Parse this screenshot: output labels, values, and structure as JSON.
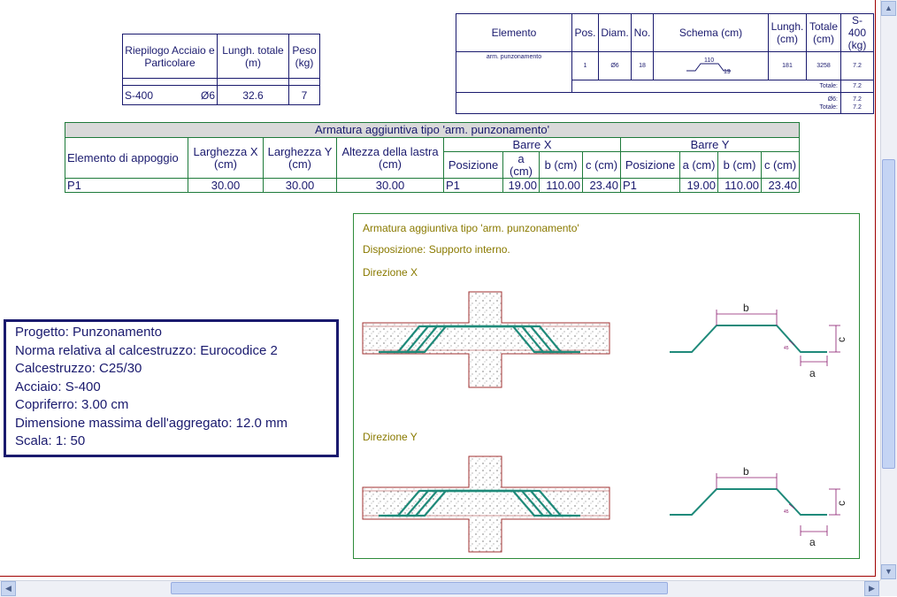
{
  "riepilogo": {
    "header": [
      "Riepilogo Acciaio e Particolare",
      "Lungh. totale (m)",
      "Peso (kg)"
    ],
    "row": {
      "material": "S-400",
      "diam": "Ø6",
      "length": "32.6",
      "weight": "7"
    }
  },
  "elemento_table": {
    "headers": [
      "Elemento",
      "Pos.",
      "Diam.",
      "No.",
      "Schema (cm)",
      "Lungh. (cm)",
      "Totale (cm)",
      "S-400 (kg)"
    ],
    "row": {
      "elemento": "arm.    punzonamento",
      "pos": "1",
      "diam": "Ø6",
      "no": "18",
      "schema_top": "110",
      "schema_side": "19",
      "lungh": "181",
      "totale": "3258",
      "kg": "7.2"
    },
    "totale_label": "Totale:",
    "totale_value": "7.2",
    "summary_labels": "Ø6:\nTotale:",
    "summary_diam_label": "Ø6:",
    "summary_diam_value": "7.2",
    "summary_total_label": "Totale:",
    "summary_total_value": "7.2"
  },
  "armatura": {
    "title": "Armatura aggiuntiva tipo 'arm. punzonamento'",
    "col_elemento": "Elemento di appoggio",
    "col_larg_x": "Larghezza X (cm)",
    "col_larg_y": "Larghezza Y (cm)",
    "col_altezza": "Altezza della lastra (cm)",
    "barre_x": "Barre X",
    "barre_y": "Barre Y",
    "posizione": "Posizione",
    "a": "a (cm)",
    "b": "b (cm)",
    "c": "c (cm)",
    "row": {
      "elemento": "P1",
      "larg_x": "30.00",
      "larg_y": "30.00",
      "altezza": "30.00",
      "x_pos": "P1",
      "x_a": "19.00",
      "x_b": "110.00",
      "x_c": "23.40",
      "y_pos": "P1",
      "y_a": "19.00",
      "y_b": "110.00",
      "y_c": "23.40"
    }
  },
  "progetto": {
    "lines": [
      "Progetto:   Punzonamento",
      "Norma relativa al calcestruzzo: Eurocodice 2",
      "Calcestruzzo:  C25/30",
      "Acciaio: S-400",
      "Copriferro: 3.00 cm",
      "Dimensione  massima  dell'aggregato:  12.0  mm",
      "Scala: 1: 50"
    ]
  },
  "panel": {
    "title": "Armatura aggiuntiva tipo 'arm. punzonamento'",
    "disposizione": "Disposizione: Supporto interno.",
    "dir_x": "Direzione X",
    "dir_y": "Direzione Y",
    "label_b": "b",
    "label_c": "c",
    "label_a": "a",
    "angle": "45"
  },
  "colors": {
    "navy": "#1a1a6e",
    "green_border": "#2e8b3a",
    "rebar": "#1f8a7a",
    "dim": "#8b1a6e",
    "olive_text": "#8a7a00",
    "concrete_outline": "#a03030"
  }
}
